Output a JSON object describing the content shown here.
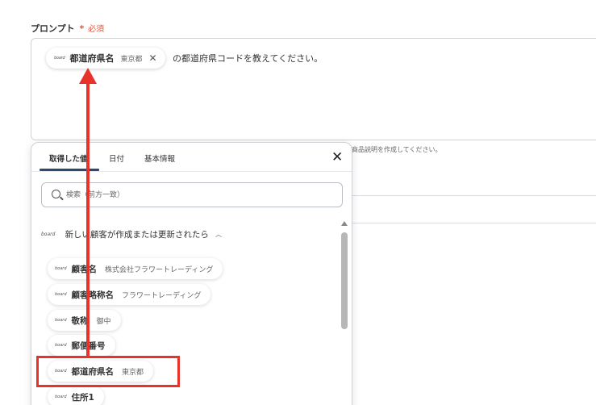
{
  "prompt": {
    "label": "プロンプト",
    "required_mark": "*",
    "required_text": "必須",
    "chip": {
      "logo": "board",
      "label": "都道府県名",
      "value": "東京都"
    },
    "text": "の都道府県コードを教えてください。"
  },
  "helper_text": "商品説明を作成してください。",
  "popup": {
    "tabs": [
      "取得した値",
      "日付",
      "基本情報"
    ],
    "active_tab": "取得した値",
    "search": {
      "placeholder": "検索（前方一致）"
    },
    "section": {
      "logo": "board",
      "title": "新しい顧客が作成または更新されたら"
    },
    "items": [
      {
        "logo": "board",
        "label": "顧客名",
        "value": "株式会社フラワートレーディング"
      },
      {
        "logo": "board",
        "label": "顧客略称名",
        "value": "フラワートレーディング"
      },
      {
        "logo": "board",
        "label": "敬称",
        "value": "御中"
      },
      {
        "logo": "board",
        "label": "郵便番号",
        "value": ""
      },
      {
        "logo": "board",
        "label": "都道府県名",
        "value": "東京都"
      },
      {
        "logo": "board",
        "label": "住所1",
        "value": ""
      }
    ]
  },
  "colors": {
    "accent_red": "#e8332a",
    "tab_underline": "#2c4a6b",
    "required": "#e8553d"
  }
}
